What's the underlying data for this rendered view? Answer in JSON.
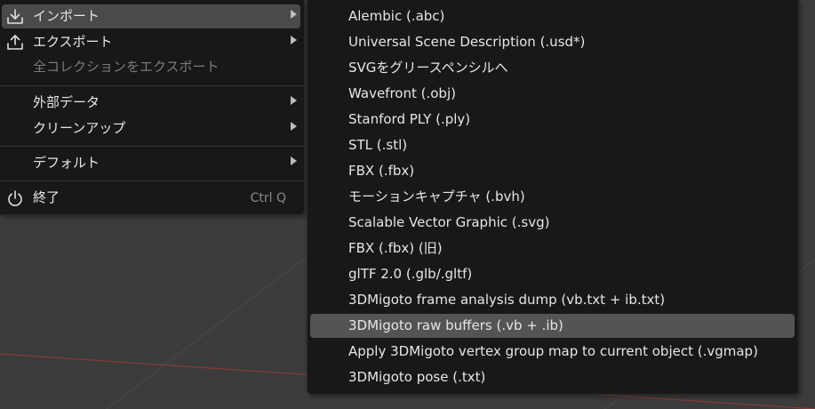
{
  "file_menu": {
    "items": [
      {
        "label": "インポート",
        "icon": "import-icon",
        "has_submenu": true,
        "active": true
      },
      {
        "label": "エクスポート",
        "icon": "export-icon",
        "has_submenu": true
      },
      {
        "label": "全コレクションをエクスポート",
        "disabled": true
      },
      {
        "label": "外部データ",
        "has_submenu": true
      },
      {
        "label": "クリーンアップ",
        "has_submenu": true
      },
      {
        "label": "デフォルト",
        "has_submenu": true
      },
      {
        "label": "終了",
        "icon": "power-icon",
        "shortcut": "Ctrl Q"
      }
    ]
  },
  "import_submenu": {
    "items": [
      {
        "label": "Alembic (.abc)"
      },
      {
        "label": "Universal Scene Description (.usd*)"
      },
      {
        "label": "SVGをグリースペンシルへ"
      },
      {
        "label": "Wavefront (.obj)"
      },
      {
        "label": "Stanford PLY (.ply)"
      },
      {
        "label": "STL (.stl)"
      },
      {
        "label": "FBX (.fbx)"
      },
      {
        "label": "モーションキャプチャ (.bvh)"
      },
      {
        "label": "Scalable Vector Graphic (.svg)"
      },
      {
        "label": "FBX (.fbx) (旧)"
      },
      {
        "label": "glTF 2.0 (.glb/.gltf)"
      },
      {
        "label": "3DMigoto frame analysis dump (vb.txt + ib.txt)"
      },
      {
        "label": "3DMigoto raw buffers (.vb + .ib)",
        "active": true
      },
      {
        "label": "Apply 3DMigoto vertex group map to current object (.vgmap)"
      },
      {
        "label": "3DMigoto pose (.txt)"
      }
    ]
  },
  "colors": {
    "menu_bg": "#181818",
    "highlight": "#545454",
    "text": "#e6e6e6",
    "disabled_text": "#7a7a7a",
    "viewport_bg": "#3c3c3c"
  }
}
